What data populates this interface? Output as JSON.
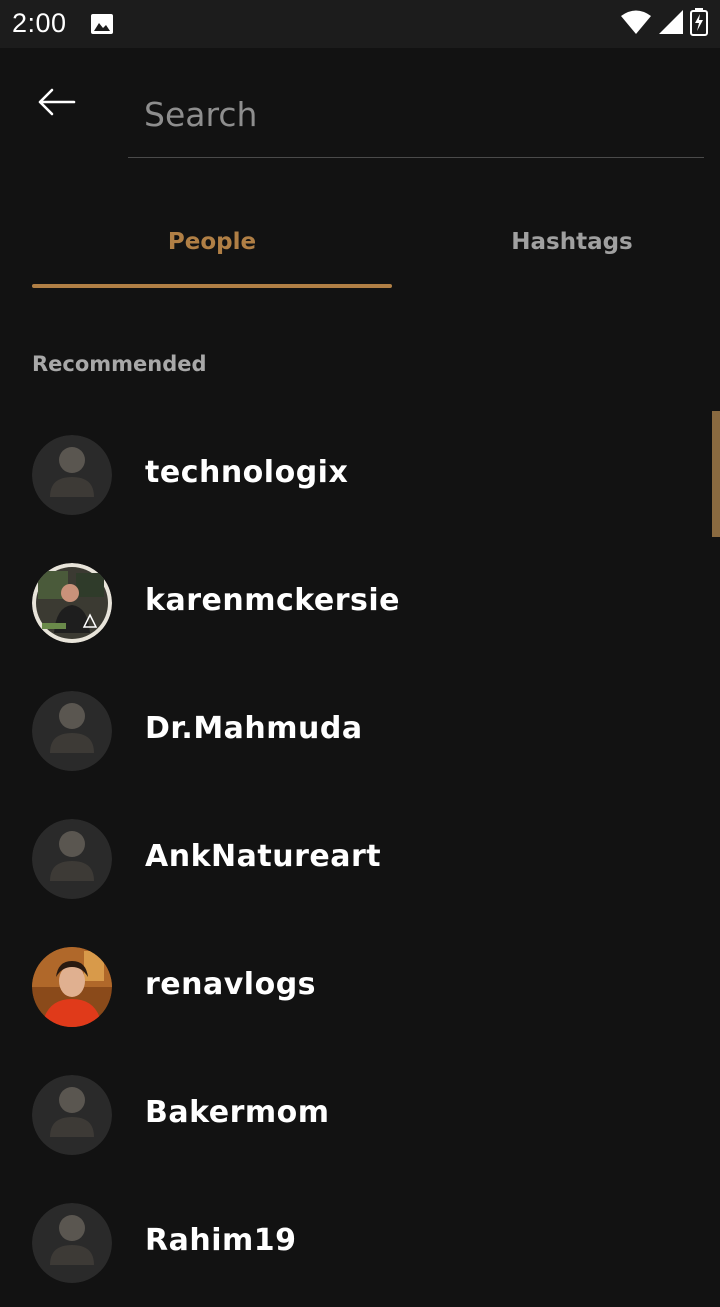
{
  "status_bar": {
    "time": "2:00",
    "icons": [
      "gallery-icon",
      "wifi-icon",
      "signal-icon",
      "battery-icon"
    ]
  },
  "header": {
    "back_icon": "arrow-left-icon",
    "search_placeholder": "Search",
    "search_value": ""
  },
  "tabs": [
    {
      "label": "People",
      "active": true
    },
    {
      "label": "Hashtags",
      "active": false
    }
  ],
  "section": {
    "label": "Recommended"
  },
  "users": [
    {
      "name": "technologix",
      "avatar": "default-avatar-icon"
    },
    {
      "name": "karenmckersie",
      "avatar": "photo-avatar"
    },
    {
      "name": "Dr.Mahmuda",
      "avatar": "default-avatar-icon"
    },
    {
      "name": "AnkNatureart",
      "avatar": "default-avatar-icon"
    },
    {
      "name": "renavlogs",
      "avatar": "photo-avatar"
    },
    {
      "name": "Bakermom",
      "avatar": "default-avatar-icon"
    },
    {
      "name": "Rahim19",
      "avatar": "default-avatar-icon"
    }
  ],
  "colors": {
    "background": "#121212",
    "accent": "#b07f45",
    "inactive_tab": "#a0a0a0",
    "section_label": "#a8a8a8"
  }
}
